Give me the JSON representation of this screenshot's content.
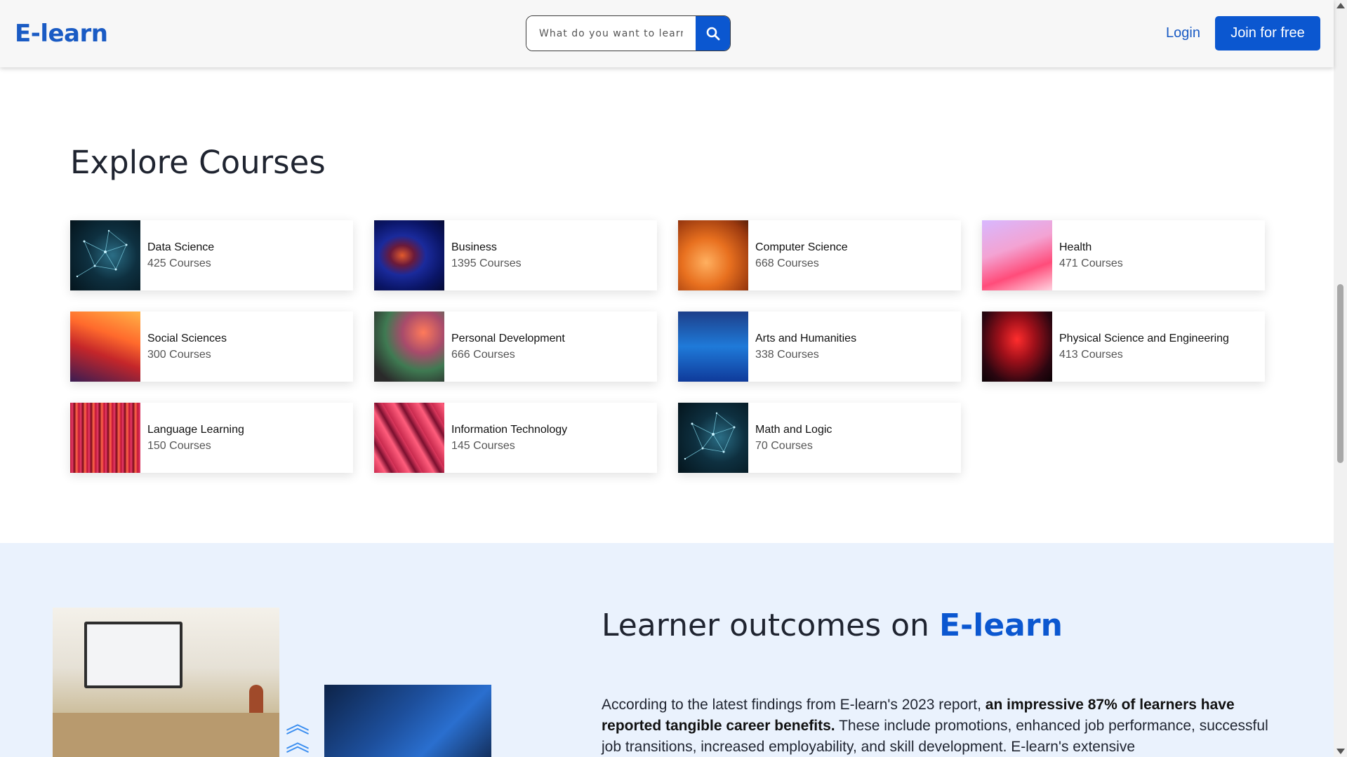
{
  "header": {
    "logo": "E-learn",
    "search_placeholder": "What do you want to learn?",
    "login_label": "Login",
    "join_label": "Join for free"
  },
  "explore": {
    "title": "Explore Courses",
    "courses": [
      {
        "title": "Data Science",
        "count": "425 Courses",
        "thumb": "t-network"
      },
      {
        "title": "Business",
        "count": "1395 Courses",
        "thumb": "t-business"
      },
      {
        "title": "Computer Science",
        "count": "668 Courses",
        "thumb": "t-cs"
      },
      {
        "title": "Health",
        "count": "471 Courses",
        "thumb": "t-health"
      },
      {
        "title": "Social Sciences",
        "count": "300 Courses",
        "thumb": "t-social"
      },
      {
        "title": "Personal Development",
        "count": "666 Courses",
        "thumb": "t-personal"
      },
      {
        "title": "Arts and Humanities",
        "count": "338 Courses",
        "thumb": "t-arts"
      },
      {
        "title": "Physical Science and Engineering",
        "count": "413 Courses",
        "thumb": "t-physical"
      },
      {
        "title": "Language Learning",
        "count": "150 Courses",
        "thumb": "t-language"
      },
      {
        "title": "Information Technology",
        "count": "145 Courses",
        "thumb": "t-it"
      },
      {
        "title": "Math and Logic",
        "count": "70 Courses",
        "thumb": "t-network"
      }
    ]
  },
  "outcomes": {
    "title_prefix": "Learner outcomes on ",
    "title_brand": "E-learn",
    "text_intro": "According to the latest findings from E-learn's 2023 report, ",
    "text_bold": "an impressive 87% of learners have reported tangible career benefits.",
    "text_rest": " These include promotions, enhanced job performance, successful job transitions, increased employability, and skill development. E-learn's extensive"
  },
  "colors": {
    "brand": "#0b57d0",
    "logo": "#1a5bc4",
    "section_bg": "#eaf2fd"
  },
  "icons": {
    "search": "search-icon",
    "chevrons": "double-chevron-up-icon"
  }
}
